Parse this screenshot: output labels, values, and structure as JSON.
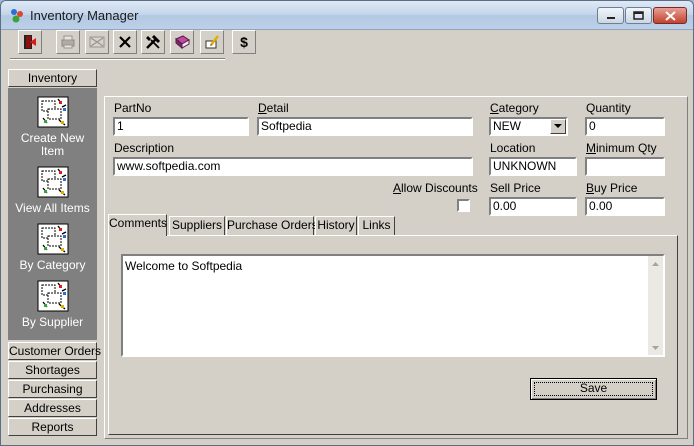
{
  "window": {
    "title": "Inventory Manager"
  },
  "toolbar": {
    "icons": [
      "exit-icon",
      "print-icon",
      "print-preview-icon",
      "delete-icon",
      "tools-icon",
      "book-icon",
      "note-icon",
      "dollar-icon"
    ],
    "dollar_label": "$"
  },
  "sidebar": {
    "header": "Inventory",
    "items": [
      "Create New Item",
      "View All Items",
      "By Category",
      "By Supplier"
    ],
    "sections": [
      "Customer Orders",
      "Shortages",
      "Purchasing",
      "Addresses",
      "Reports"
    ]
  },
  "form": {
    "partno_label": "PartNo",
    "partno_value": "1",
    "detail_label_u": "D",
    "detail_label_rest": "etail",
    "detail_value": "Softpedia",
    "category_label_u": "C",
    "category_label_rest": "ategory",
    "category_value": "NEW",
    "quantity_label": "Quantity",
    "quantity_value": "0",
    "description_label": "Description",
    "description_value": "www.softpedia.com",
    "location_label": "Location",
    "location_value": "UNKNOWN",
    "minqty_label_u": "M",
    "minqty_label_rest": "inimum Qty",
    "minqty_value": "",
    "allow_label_u": "A",
    "allow_label_rest": "llow Discounts",
    "allow_checked": false,
    "sell_label": "Sell Price",
    "sell_value": "0.00",
    "buy_label_u": "B",
    "buy_label_rest": "uy Price",
    "buy_value": "0.00"
  },
  "tabs": [
    "Comments",
    "Suppliers",
    "Purchase Orders",
    "History",
    "Links"
  ],
  "comments": {
    "text": "Welcome to Softpedia"
  },
  "save_label": "Save"
}
